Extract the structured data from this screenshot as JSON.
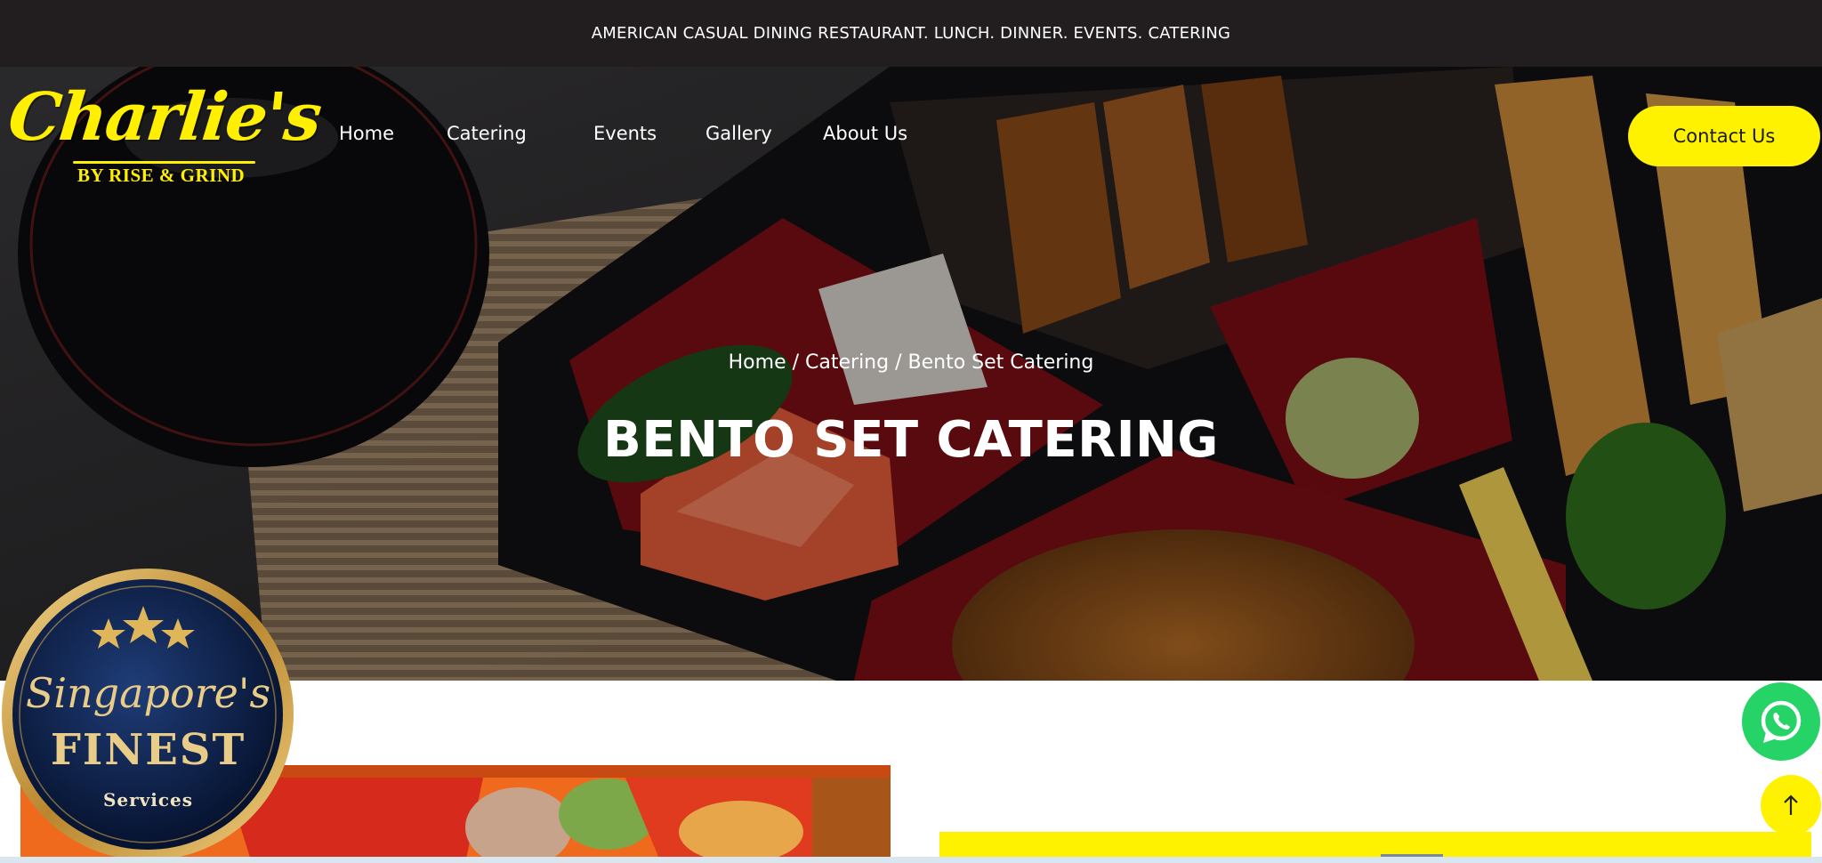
{
  "topbar": {
    "text": "AMERICAN CASUAL DINING RESTAURANT. LUNCH. DINNER. EVENTS. CATERING"
  },
  "logo": {
    "script": "Charlie's",
    "sub": "BY RISE & GRIND"
  },
  "nav": {
    "items": [
      {
        "label": "Home"
      },
      {
        "label": "Catering"
      },
      {
        "label": "Events"
      },
      {
        "label": "Gallery"
      },
      {
        "label": "About Us"
      }
    ]
  },
  "header": {
    "contact_label": "Contact Us"
  },
  "hero": {
    "breadcrumb": {
      "home": "Home",
      "sep1": " / ",
      "catering": "Catering",
      "sep2": " / ",
      "current": "Bento Set Catering"
    },
    "title": "BENTO SET CATERING"
  },
  "badge": {
    "line1": "Singapore's",
    "line2": "FINEST",
    "line3": "Services",
    "stars": 3
  },
  "icons": {
    "whatsapp": "whatsapp-icon",
    "back_to_top": "arrow-up-icon"
  },
  "colors": {
    "accent": "#fff200",
    "topbar": "#221e1f",
    "whatsapp": "#25d366",
    "badge_navy": "#0f2650",
    "badge_gold": "#c9a14c"
  }
}
